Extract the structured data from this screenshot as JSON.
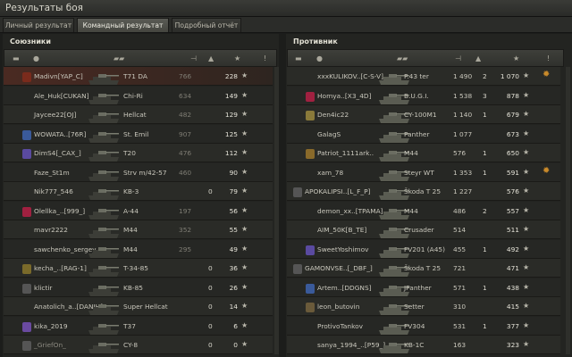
{
  "window": {
    "title": "Результаты боя"
  },
  "tabs": [
    {
      "label": "Личный результат",
      "active": false
    },
    {
      "label": "Командный результат",
      "active": true
    },
    {
      "label": "Подробный отчёт",
      "active": false
    }
  ],
  "allies": {
    "title": "Союзники",
    "rows": [
      {
        "name": "Madivn[YAP_C]",
        "tank": "T71 DA",
        "xp": "766",
        "kills": "",
        "points": "228",
        "highlight": true,
        "dead": false
      },
      {
        "name": "Ale_Huk[CUKAN]",
        "tank": "Chi-Ri",
        "xp": "634",
        "kills": "",
        "points": "149",
        "highlight": false,
        "dead": false
      },
      {
        "name": "Jaycee22[OJ]",
        "tank": "Hellcat",
        "xp": "482",
        "kills": "",
        "points": "129",
        "highlight": false,
        "dead": false
      },
      {
        "name": "WOWATA..[76R]",
        "tank": "St. Emil",
        "xp": "907",
        "kills": "",
        "points": "125",
        "highlight": false,
        "dead": false
      },
      {
        "name": "DimS4[_CAX_]",
        "tank": "T20",
        "xp": "476",
        "kills": "",
        "points": "112",
        "highlight": false,
        "dead": false
      },
      {
        "name": "Faze_St1m",
        "tank": "Strv m/42-57",
        "xp": "460",
        "kills": "",
        "points": "90",
        "highlight": false,
        "dead": false
      },
      {
        "name": "Nik777_546",
        "tank": "KB-3",
        "xp": "",
        "kills": "0",
        "points": "79",
        "highlight": false,
        "dead": false
      },
      {
        "name": "Olellka_..[999_]",
        "tank": "A-44",
        "xp": "197",
        "kills": "",
        "points": "56",
        "highlight": false,
        "dead": false
      },
      {
        "name": "mavr2222",
        "tank": "M44",
        "xp": "352",
        "kills": "",
        "points": "55",
        "highlight": false,
        "dead": false
      },
      {
        "name": "sawchenko_sergey",
        "tank": "M44",
        "xp": "295",
        "kills": "",
        "points": "49",
        "highlight": false,
        "dead": false
      },
      {
        "name": "kecha_..[RAG-1]",
        "tank": "T-34-85",
        "xp": "",
        "kills": "0",
        "points": "36",
        "highlight": false,
        "dead": false
      },
      {
        "name": "klictir",
        "tank": "KB-85",
        "xp": "",
        "kills": "0",
        "points": "26",
        "highlight": false,
        "dead": false
      },
      {
        "name": "Anatolich_a..[DANIH]",
        "tank": "Super Hellcat",
        "xp": "",
        "kills": "0",
        "points": "14",
        "highlight": false,
        "dead": false
      },
      {
        "name": "kika_2019",
        "tank": "T37",
        "xp": "",
        "kills": "0",
        "points": "6",
        "highlight": false,
        "dead": false
      },
      {
        "name": "_GriefOn_",
        "tank": "CY-8",
        "xp": "",
        "kills": "0",
        "points": "0",
        "highlight": false,
        "dead": true
      }
    ]
  },
  "enemies": {
    "title": "Противник",
    "rows": [
      {
        "name": "xxxKULIKOV..[C-S-V]",
        "tank": "P.43 ter",
        "xp": "1 490",
        "kills": "2",
        "points": "1 070",
        "medal": true
      },
      {
        "name": "Homya..[X3_4D]",
        "tank": "B.U.G.I.",
        "xp": "1 538",
        "kills": "3",
        "points": "878",
        "medal": false
      },
      {
        "name": "Den4ic22",
        "tank": "CY-100M1",
        "xp": "1 140",
        "kills": "1",
        "points": "679",
        "medal": false
      },
      {
        "name": "GalagS",
        "tank": "Panther",
        "xp": "1 077",
        "kills": "",
        "points": "673",
        "medal": false
      },
      {
        "name": "Patriot_1111ark..",
        "tank": "M44",
        "xp": "576",
        "kills": "1",
        "points": "650",
        "medal": false
      },
      {
        "name": "xam_78",
        "tank": "Steyr WT",
        "xp": "1 353",
        "kills": "1",
        "points": "591",
        "medal": true
      },
      {
        "name": "APOKALIPSI..[L_F_P]",
        "tank": "Škoda T 25",
        "xp": "1 227",
        "kills": "",
        "points": "576",
        "medal": false
      },
      {
        "name": "demon_xx..[TPAMA]",
        "tank": "M44",
        "xp": "486",
        "kills": "2",
        "points": "557",
        "medal": false
      },
      {
        "name": "AIM_50K[B_TE]",
        "tank": "Crusader",
        "xp": "514",
        "kills": "",
        "points": "511",
        "medal": false
      },
      {
        "name": "SweetYoshimov",
        "tank": "FV201 (A45)",
        "xp": "455",
        "kills": "1",
        "points": "492",
        "medal": false
      },
      {
        "name": "GAMONVSE..[_DBF_]",
        "tank": "Škoda T 25",
        "xp": "721",
        "kills": "",
        "points": "471",
        "medal": false
      },
      {
        "name": "Artem..[DDGNS]",
        "tank": "JPanther",
        "xp": "571",
        "kills": "1",
        "points": "438",
        "medal": false
      },
      {
        "name": "leon_butovin",
        "tank": "Setter",
        "xp": "310",
        "kills": "",
        "points": "415",
        "medal": false
      },
      {
        "name": "ProtivoTankov",
        "tank": "FV304",
        "xp": "531",
        "kills": "1",
        "points": "377",
        "medal": false
      },
      {
        "name": "sanya_1994_..[P59_]",
        "tank": "KB-1C",
        "xp": "163",
        "kills": "",
        "points": "323",
        "medal": false
      }
    ]
  }
}
